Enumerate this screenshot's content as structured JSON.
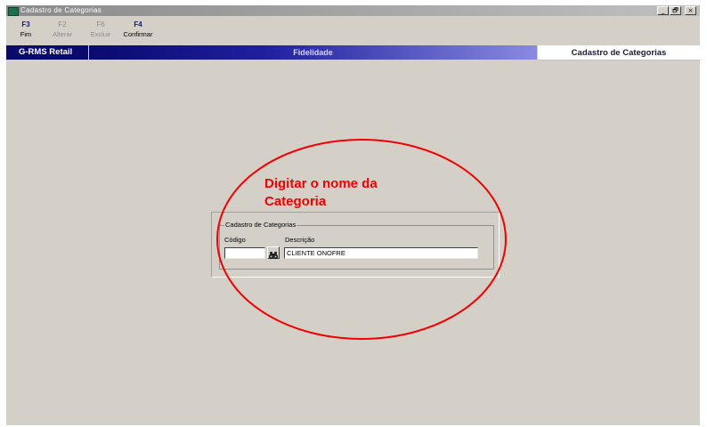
{
  "window": {
    "title": "Cadastro de Categorias",
    "controls": [
      "_",
      "🗗",
      "×"
    ]
  },
  "toolbar": {
    "keys": [
      {
        "key": "F3",
        "label": "Fim",
        "enabled": true
      },
      {
        "key": "F2",
        "label": "Alterar",
        "enabled": false
      },
      {
        "key": "F6",
        "label": "Excluir",
        "enabled": false
      },
      {
        "key": "F4",
        "label": "Confirmar",
        "enabled": true
      }
    ]
  },
  "header": {
    "brand": "G-RMS Retail",
    "module": "Fidelidade",
    "screen_title": "Cadastro de Categorias"
  },
  "form": {
    "group_label": "Cadastro de Categorias",
    "codigo_label": "Código",
    "codigo_value": "",
    "descricao_label": "Descrição",
    "descricao_value": "CLIENTE ONOFRE"
  },
  "annotation": {
    "text": "Digitar o nome da Categoria",
    "color": "#f20000"
  },
  "colors": {
    "background": "#d4d0c8",
    "brand_bar": "#0a0a6e",
    "annotation": "#f20000"
  }
}
